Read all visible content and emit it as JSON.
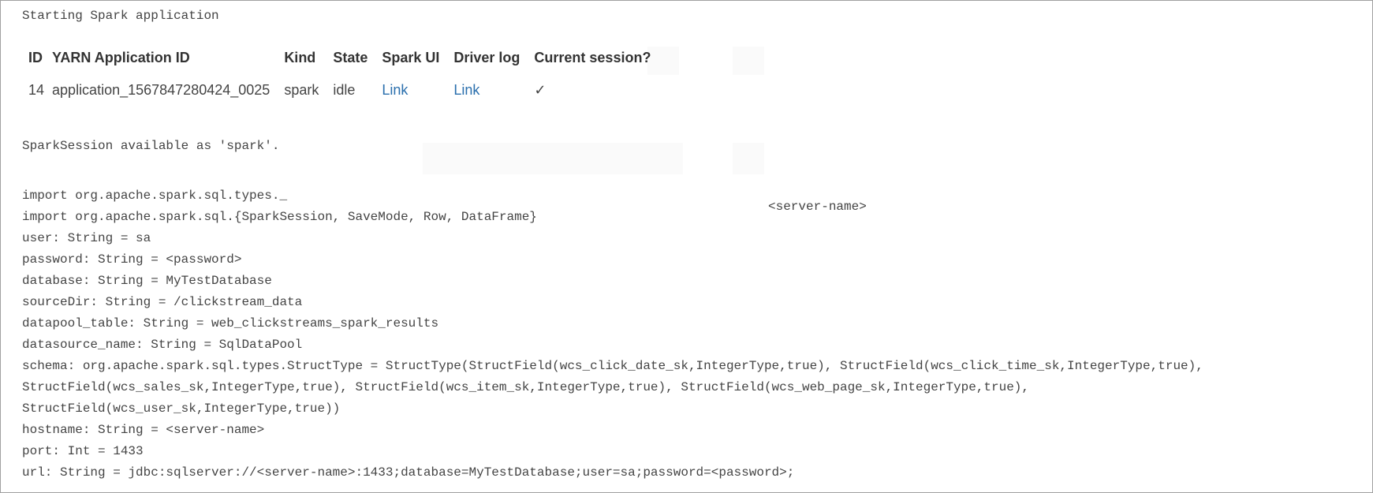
{
  "output": {
    "start_message": "Starting Spark application",
    "session_message": "SparkSession available as 'spark'.",
    "server_label": "<server-name>"
  },
  "session_table": {
    "headers": [
      "ID",
      "YARN Application ID",
      "Kind",
      "State",
      "Spark UI",
      "Driver log",
      "Current session?"
    ],
    "rows": [
      {
        "id": "14",
        "yarn_app_id": "application_1567847280424_0025",
        "kind": "spark",
        "state": "idle",
        "spark_ui": "Link",
        "driver_log": "Link",
        "current_session": "✓"
      }
    ]
  },
  "code_output": [
    "import org.apache.spark.sql.types._",
    "import org.apache.spark.sql.{SparkSession, SaveMode, Row, DataFrame}",
    "user: String = sa",
    "password: String = <password>",
    "database: String = MyTestDatabase",
    "sourceDir: String = /clickstream_data",
    "datapool_table: String = web_clickstreams_spark_results",
    "datasource_name: String = SqlDataPool",
    "schema: org.apache.spark.sql.types.StructType = StructType(StructField(wcs_click_date_sk,IntegerType,true), StructField(wcs_click_time_sk,IntegerType,true),",
    "StructField(wcs_sales_sk,IntegerType,true), StructField(wcs_item_sk,IntegerType,true), StructField(wcs_web_page_sk,IntegerType,true),",
    "StructField(wcs_user_sk,IntegerType,true))",
    "hostname: String = <server-name>",
    "port: Int = 1433",
    "url: String = jdbc:sqlserver://<server-name>:1433;database=MyTestDatabase;user=sa;password=<password>;"
  ]
}
